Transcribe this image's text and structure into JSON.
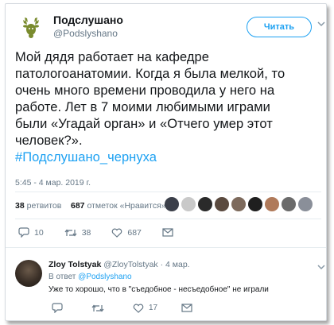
{
  "tweet": {
    "author_name": "Подслушано",
    "author_handle": "@Podslyshano",
    "follow_label": "Читать",
    "text_lines": [
      "Мой дядя работает на кафедре",
      "патологоанатомии. Когда я была мелкой, то",
      "очень много времени проводила у него на",
      "работе. Лет в 7 моими любимыми играми",
      "были «Угадай орган» и «Отчего умер этот",
      "человек?»."
    ],
    "hashtag": "#Подслушано_чернуха",
    "timestamp": "5:45 - 4 мар. 2019 г.",
    "retweets_count": "38",
    "retweets_label": "ретвитов",
    "likes_count": "687",
    "likes_label": "отметок «Нравится»",
    "actions": {
      "reply_count": "10",
      "retweet_count": "38",
      "like_count": "687"
    }
  },
  "reply": {
    "name": "Zloy Tolstyak",
    "handle_date": "@ZloyTolstyak · 4 мар.",
    "reply_to_prefix": "В ответ",
    "reply_to_mention": "@Podslyshano",
    "text": "Уже то хорошо, что в \"съедобное - несъедобное\" не играли",
    "actions": {
      "like_count": "17"
    }
  },
  "colors": {
    "accent": "#1da1f2",
    "secondary_text": "#657786",
    "primary_text": "#14171a"
  },
  "icons": [
    "deer-logo-icon",
    "chevron-down-icon",
    "reply-icon",
    "retweet-icon",
    "heart-icon",
    "envelope-icon"
  ]
}
